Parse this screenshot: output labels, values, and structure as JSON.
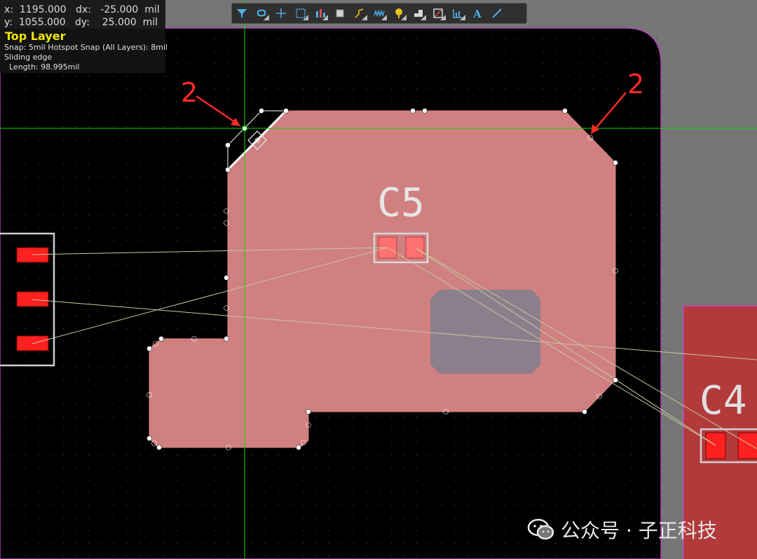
{
  "readout": {
    "x_line": "x:  1195.000   dx:   -25.000  mil",
    "y_line": "y:  1055.000   dy:    25.000  mil",
    "layer": "Top Layer",
    "snap": "Snap: 5mil Hotspot Snap (All Layers): 8mil",
    "mode": "Sliding edge",
    "length": "  Length: 98.995mil"
  },
  "toolbar": {
    "items": [
      {
        "name": "filter-icon",
        "dropdown": false
      },
      {
        "name": "route-icon",
        "dropdown": true
      },
      {
        "name": "add-icon",
        "dropdown": false
      },
      {
        "name": "select-rect-icon",
        "dropdown": true
      },
      {
        "name": "align-icon",
        "dropdown": true
      },
      {
        "name": "component-icon",
        "dropdown": false
      },
      {
        "name": "interactive-route-icon",
        "dropdown": true
      },
      {
        "name": "length-tune-icon",
        "dropdown": true
      },
      {
        "name": "pad-via-icon",
        "dropdown": true
      },
      {
        "name": "fill-icon",
        "dropdown": true
      },
      {
        "name": "region-icon",
        "dropdown": true
      },
      {
        "name": "chart-icon",
        "dropdown": true
      },
      {
        "name": "text-icon",
        "dropdown": false
      },
      {
        "name": "line-icon",
        "dropdown": false
      }
    ]
  },
  "canvas": {
    "designator_c5": "C5",
    "designator_c4": "C4",
    "annotation_left": "2",
    "annotation_right": "2"
  },
  "watermark": {
    "text": "公众号 · 子正科技"
  },
  "colors": {
    "board": "#000000",
    "polygon": "#d08080",
    "keepout": "#8c7f8c",
    "pad": "#ff2020",
    "silk": "#e0e0e0",
    "crosshair": "#00e000",
    "annotation": "#ff2a2a",
    "ratsnest": "#c8c8a0"
  }
}
